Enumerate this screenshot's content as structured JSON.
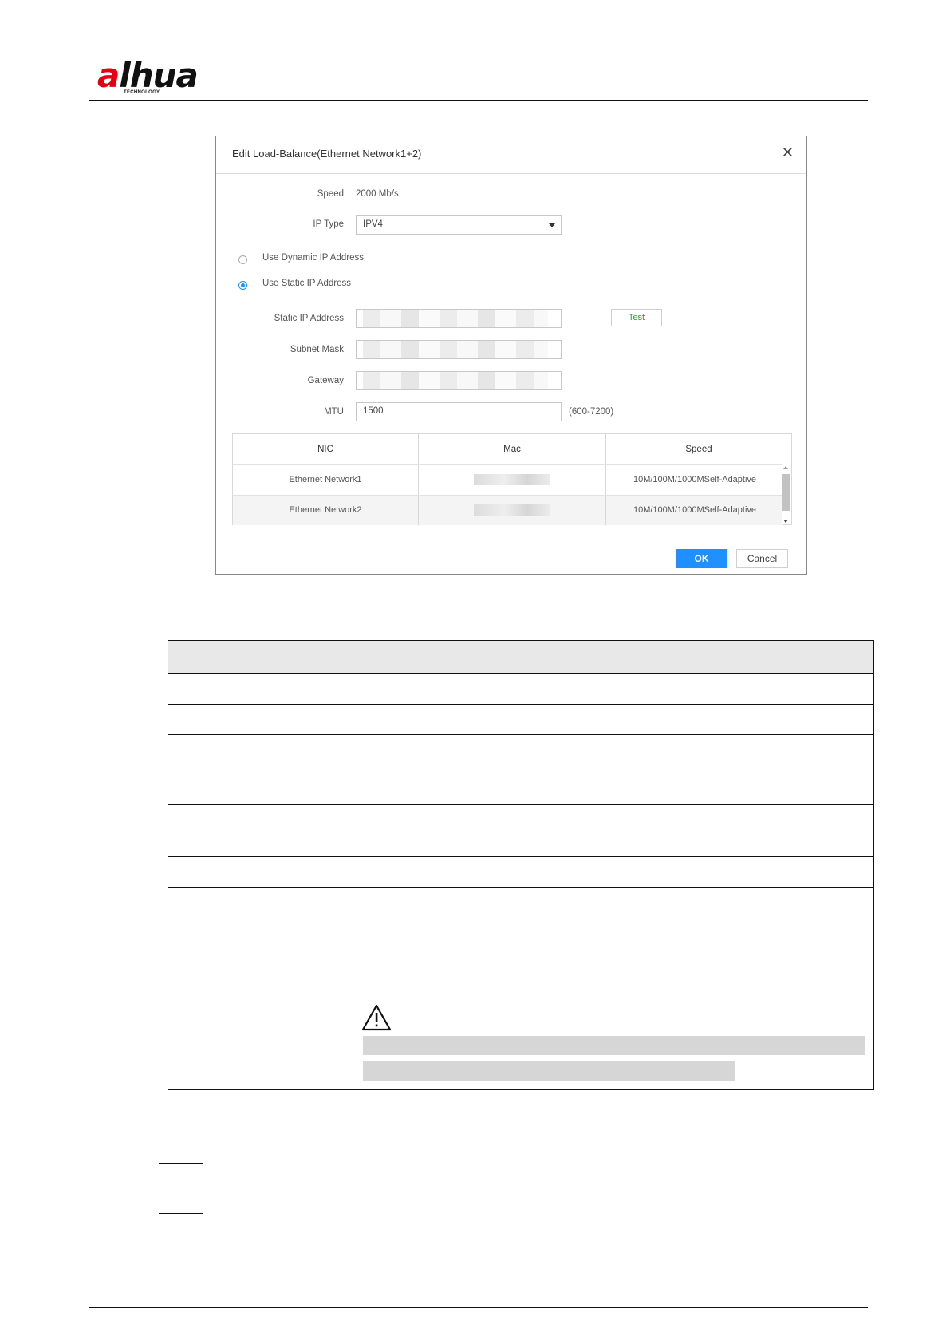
{
  "header": {
    "brand": "alhua",
    "brand_accent": "a",
    "brand_rest": "lhua",
    "brand_sub": "TECHNOLOGY",
    "brand_color": "#e60012"
  },
  "dialog": {
    "title": "Edit Load-Balance(Ethernet Network1+2)",
    "close_icon": "close-icon",
    "speed_label": "Speed",
    "speed_value": "2000 Mb/s",
    "ip_type_label": "IP Type",
    "ip_type_value": "IPV4",
    "dynamic_ip_label": "Use Dynamic IP Address",
    "static_ip_radio_label": "Use Static IP Address",
    "selected_mode": "static",
    "static_ip_label": "Static IP Address",
    "subnet_mask_label": "Subnet Mask",
    "gateway_label": "Gateway",
    "mtu_label": "MTU",
    "mtu_value": "1500",
    "mtu_range": "(600-7200)",
    "test_label": "Test",
    "ok_label": "OK",
    "cancel_label": "Cancel",
    "accent_color": "#1e90ff",
    "test_color": "#2a9d3e"
  },
  "nic_table": {
    "headers": {
      "nic": "NIC",
      "mac": "Mac",
      "speed": "Speed"
    },
    "rows": [
      {
        "nic": "Ethernet Network1",
        "speed": "10M/100M/1000MSelf-Adaptive"
      },
      {
        "nic": "Ethernet Network2",
        "speed": "10M/100M/1000MSelf-Adaptive"
      }
    ]
  }
}
